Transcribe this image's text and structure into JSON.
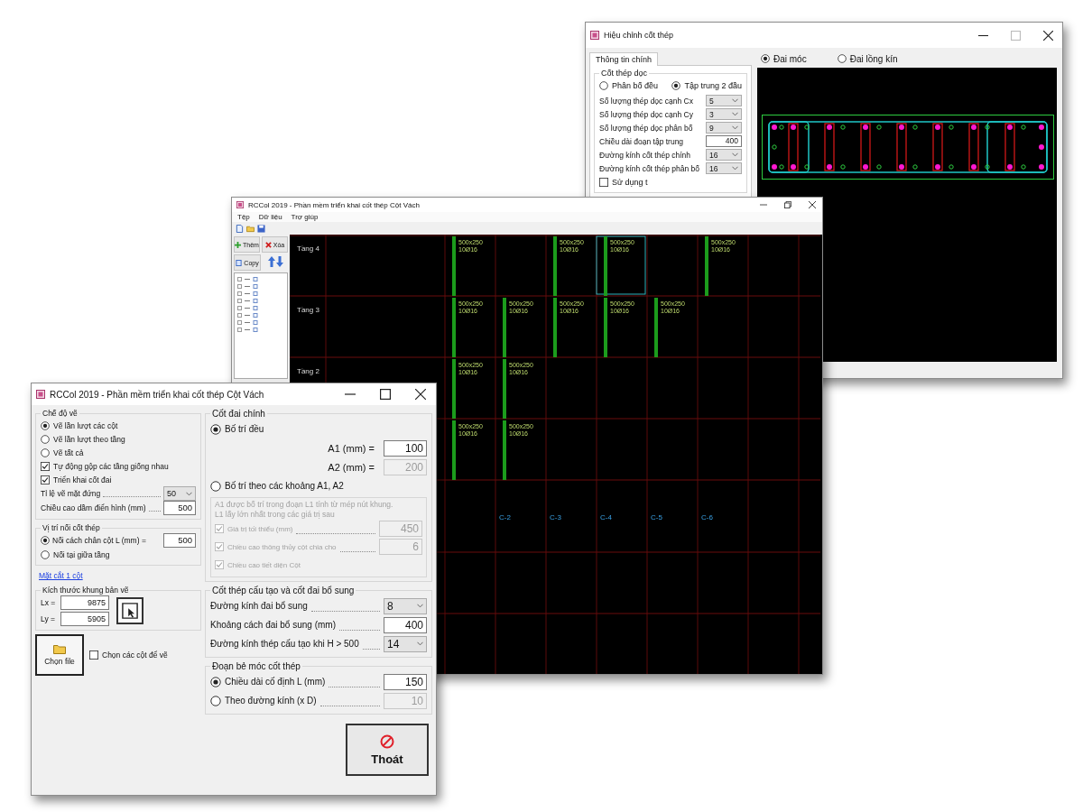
{
  "edit_window": {
    "title": "Hiệu chỉnh cốt thép",
    "tabs": [
      {
        "label": "Thông tin chính",
        "selected": true
      }
    ],
    "longitudinal": {
      "title": "Cốt thép dọc",
      "modes": [
        {
          "label": "Phân bố đều",
          "selected": false
        },
        {
          "label": "Tập trung 2 đầu",
          "selected": true
        }
      ],
      "fields": [
        {
          "label": "Số lượng thép dọc cạnh Cx",
          "value": "5",
          "kind": "dropdown"
        },
        {
          "label": "Số lượng thép dọc cạnh Cy",
          "value": "3",
          "kind": "dropdown"
        },
        {
          "label": "Số lượng thép dọc phân bố",
          "value": "9",
          "kind": "dropdown"
        },
        {
          "label": "Chiều dài đoạn tập trung",
          "value": "400",
          "kind": "text"
        },
        {
          "label": "Đường kính cốt thép chính",
          "value": "16",
          "kind": "dropdown"
        },
        {
          "label": "Đường kính cốt thép phân bố",
          "value": "16",
          "kind": "dropdown"
        }
      ],
      "option": {
        "label": "Sử dụng t",
        "checked": false
      }
    },
    "stirrup_types": [
      {
        "label": "Đai móc",
        "selected": true
      },
      {
        "label": "Đai lồng kín",
        "selected": false
      }
    ]
  },
  "main_window": {
    "title": "RCCol 2019 - Phần mềm triển khai cốt thép Cột Vách",
    "menu": [
      "Tệp",
      "Dữ liệu",
      "Trợ giúp"
    ],
    "tool_buttons": [
      "Thêm",
      "Xóa",
      "Copy"
    ],
    "stories": [
      "Tầng 4",
      "Tầng 3",
      "Tầng 2"
    ],
    "columns": [
      {
        "segments": [
          {
            "kind": "section",
            "size": "500x250",
            "rebar": "10Ø16",
            "selected": false
          },
          {
            "kind": "section",
            "size": "500x250",
            "rebar": "10Ø16",
            "selected": false
          },
          {
            "kind": "section",
            "size": "500x250",
            "rebar": "10Ø16",
            "selected": false
          },
          {
            "kind": "section",
            "size": "500x250",
            "rebar": "10Ø16",
            "selected": false
          }
        ]
      },
      {
        "label": "C-2",
        "segments": [
          {
            "kind": "gap"
          },
          {
            "kind": "section",
            "size": "500x250",
            "rebar": "10Ø16",
            "selected": false
          },
          {
            "kind": "section",
            "size": "500x250",
            "rebar": "10Ø16",
            "selected": false
          },
          {
            "kind": "section",
            "size": "500x250",
            "rebar": "10Ø16",
            "selected": false
          }
        ]
      },
      {
        "label": "C-3",
        "segments": [
          {
            "kind": "section",
            "size": "500x250",
            "rebar": "10Ø16",
            "selected": false
          },
          {
            "kind": "section",
            "size": "500x250",
            "rebar": "10Ø16",
            "selected": false
          }
        ]
      },
      {
        "label": "C-4",
        "segments": [
          {
            "kind": "section",
            "size": "500x250",
            "rebar": "10Ø16",
            "selected": true
          },
          {
            "kind": "section",
            "size": "500x250",
            "rebar": "10Ø16",
            "selected": false
          }
        ]
      },
      {
        "label": "C-5",
        "segments": [
          {
            "kind": "gap"
          },
          {
            "kind": "section",
            "size": "500x250",
            "rebar": "10Ø16",
            "selected": false
          }
        ]
      },
      {
        "label": "C-6",
        "segments": [
          {
            "kind": "section",
            "size": "500x250",
            "rebar": "10Ø16",
            "selected": false
          }
        ]
      }
    ]
  },
  "front_window": {
    "title": "RCCol 2019 - Phần mềm triển khai cốt thép Cột Vách",
    "draw_mode": {
      "title": "Chế độ vẽ",
      "radios": [
        {
          "label": "Vẽ lần lượt các cột",
          "selected": true
        },
        {
          "label": "Vẽ lần lượt theo tầng",
          "selected": false
        },
        {
          "label": "Vẽ tất cả",
          "selected": false
        }
      ],
      "checkboxes": [
        {
          "label": "Tự động gộp các tầng giống nhau",
          "checked": true
        },
        {
          "label": "Triển khai cốt đai",
          "checked": true
        }
      ],
      "fields": [
        {
          "label": "Tỉ lệ vẽ mặt đứng",
          "value": "50",
          "kind": "dropdown"
        },
        {
          "label": "Chiều cao dầm điển hình (mm)",
          "value": "500",
          "kind": "text"
        }
      ]
    },
    "splice": {
      "title": "Vị trí nối cốt thép",
      "options": [
        {
          "label": "Nối cách chân cột L (mm) =",
          "selected": true
        },
        {
          "label": "Nối tại giữa tầng",
          "selected": false
        }
      ],
      "value": "500"
    },
    "link": "Mặt cắt 1 cột",
    "frame_size": {
      "title": "Kích thước khung bản vẽ",
      "fields": [
        {
          "label": "Lx =",
          "value": "9875"
        },
        {
          "label": "Ly =",
          "value": "5905"
        }
      ]
    },
    "open_button": "Chọn file",
    "pick_columns": {
      "label": "Chọn các cột để vẽ",
      "checked": false
    },
    "main_stirrup": {
      "title": "Cốt đai chính",
      "modes": [
        {
          "label": "Bố trí đều",
          "selected": true
        },
        {
          "label": "Bố trí theo các khoảng A1, A2",
          "selected": false
        }
      ],
      "fields": [
        {
          "label": "A1 (mm) =",
          "value": "100",
          "disabled": false
        },
        {
          "label": "A2 (mm) =",
          "value": "200",
          "disabled": true
        }
      ],
      "zone": {
        "disabled": true,
        "notes": [
          "A1 được bố trí trong đoạn L1 tính từ mép nút khung.",
          "L1 lấy lớn nhất trong các giá trị sau"
        ],
        "criteria": [
          {
            "label": "Giá trị tối thiểu (mm)",
            "checked": true,
            "value": "450"
          },
          {
            "label": "Chiều cao thông thủy cột chia cho",
            "checked": true,
            "value": "6"
          },
          {
            "label": "Chiều cao tiết diện Cột",
            "checked": true
          }
        ]
      }
    },
    "extra_rebar": {
      "title": "Cốt thép cấu tạo và cốt đai bổ sung",
      "fields": [
        {
          "label": "Đường kính đai bổ sung",
          "value": "8",
          "kind": "dropdown"
        },
        {
          "label": "Khoảng cách đai bổ sung (mm)",
          "value": "400",
          "kind": "text"
        },
        {
          "label": "Đường kính thép cấu tạo khi H > 500",
          "value": "14",
          "kind": "dropdown"
        }
      ]
    },
    "hook": {
      "title": "Đoạn bẻ móc cốt thép",
      "options": [
        {
          "label": "Chiều dài cố định L (mm)",
          "selected": true,
          "value": "150",
          "disabled": false
        },
        {
          "label": "Theo đường kính (x D)",
          "selected": false,
          "value": "10",
          "disabled": true
        }
      ]
    },
    "exit_button": "Thoát"
  }
}
